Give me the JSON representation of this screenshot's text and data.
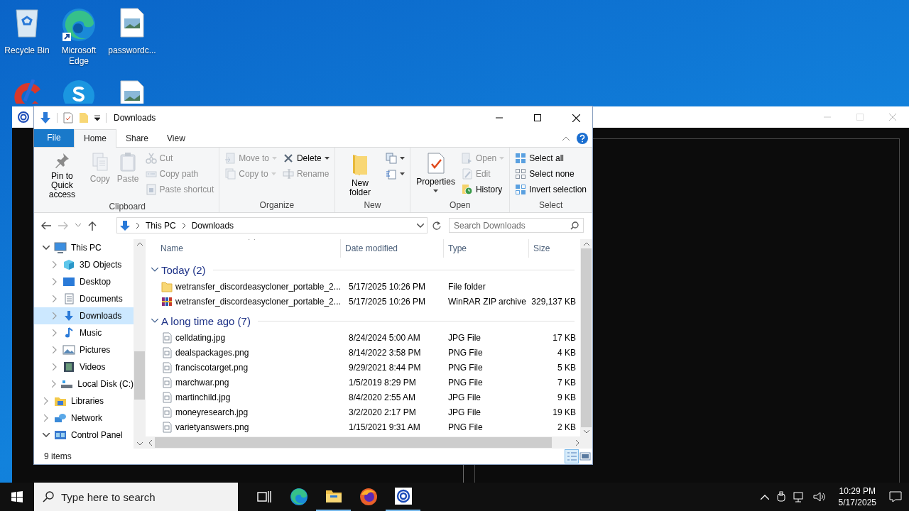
{
  "desktop_icons": [
    {
      "label": "Recycle Bin",
      "kind": "recycle"
    },
    {
      "label": "Microsoft Edge",
      "kind": "edge"
    },
    {
      "label": "passwordc...",
      "kind": "image"
    },
    {
      "kind": "cleaner"
    },
    {
      "kind": "skype"
    },
    {
      "kind": "image"
    }
  ],
  "explorer": {
    "title": "Downloads",
    "tabs": [
      {
        "label": "File",
        "kind": "file",
        "selected": false
      },
      {
        "label": "Home",
        "kind": "tab",
        "selected": true
      },
      {
        "label": "Share",
        "kind": "tab",
        "selected": false
      },
      {
        "label": "View",
        "kind": "tab",
        "selected": false
      }
    ],
    "ribbon": [
      {
        "label": "Clipboard",
        "items": [
          {
            "label": "Pin to Quick access",
            "kind": "large",
            "disabled": false
          },
          {
            "label": "Copy",
            "kind": "large",
            "disabled": true
          },
          {
            "label": "Paste",
            "kind": "large",
            "disabled": true
          },
          {
            "kind": "stack",
            "items": [
              {
                "label": "Cut",
                "disabled": true
              },
              {
                "label": "Copy path",
                "disabled": true
              },
              {
                "label": "Paste shortcut",
                "disabled": true
              }
            ]
          }
        ]
      },
      {
        "label": "Organize",
        "items": [
          {
            "kind": "stack",
            "items": [
              {
                "label": "Move to",
                "disabled": true,
                "dropdown": true
              },
              {
                "label": "Copy to",
                "disabled": true,
                "dropdown": true
              }
            ]
          },
          {
            "kind": "stack",
            "items": [
              {
                "label": "Delete",
                "disabled": false,
                "dropdown": true
              },
              {
                "label": "Rename",
                "disabled": true
              }
            ]
          }
        ]
      },
      {
        "label": "New",
        "items": [
          {
            "label": "New folder",
            "kind": "large",
            "disabled": false
          },
          {
            "kind": "iconstack",
            "items": [
              {
                "disabled": false,
                "dropdown": true
              },
              {
                "disabled": false,
                "dropdown": true
              }
            ]
          }
        ]
      },
      {
        "label": "Open",
        "items": [
          {
            "label": "Properties",
            "kind": "large",
            "disabled": false,
            "dropdown": true
          },
          {
            "kind": "stack",
            "items": [
              {
                "label": "Open",
                "disabled": true,
                "dropdown": true
              },
              {
                "label": "Edit",
                "disabled": true
              },
              {
                "label": "History",
                "disabled": false
              }
            ]
          }
        ]
      },
      {
        "label": "Select",
        "items": [
          {
            "kind": "stack",
            "items": [
              {
                "label": "Select all",
                "disabled": false
              },
              {
                "label": "Select none",
                "disabled": false
              },
              {
                "label": "Invert selection",
                "disabled": false
              }
            ]
          }
        ]
      }
    ],
    "address": {
      "crumbs": [
        "This PC",
        "Downloads"
      ]
    },
    "search": {
      "placeholder": "Search Downloads"
    },
    "nav": [
      {
        "label": "This PC",
        "expanded": true,
        "selected": false,
        "children": [
          {
            "label": "3D Objects",
            "expanded": false,
            "selected": false
          },
          {
            "label": "Desktop",
            "expanded": false,
            "selected": false
          },
          {
            "label": "Documents",
            "expanded": false,
            "selected": false
          },
          {
            "label": "Downloads",
            "expanded": false,
            "selected": true
          },
          {
            "label": "Music",
            "expanded": false,
            "selected": false
          },
          {
            "label": "Pictures",
            "expanded": false,
            "selected": false
          },
          {
            "label": "Videos",
            "expanded": false,
            "selected": false
          },
          {
            "label": "Local Disk (C:)",
            "expanded": false,
            "selected": false
          }
        ]
      },
      {
        "label": "Libraries",
        "expanded": false,
        "selected": false
      },
      {
        "label": "Network",
        "expanded": false,
        "selected": false
      },
      {
        "label": "Control Panel",
        "expanded": true,
        "selected": false
      }
    ],
    "columns": [
      "Name",
      "Date modified",
      "Type",
      "Size"
    ],
    "groups": [
      {
        "label": "Today (2)",
        "rows": [
          {
            "name": "wetransfer_discordeasycloner_portable_2...",
            "date": "5/17/2025 10:26 PM",
            "type": "File folder",
            "kind": "folder"
          },
          {
            "name": "wetransfer_discordeasycloner_portable_2...",
            "date": "5/17/2025 10:26 PM",
            "type": "WinRAR ZIP archive",
            "size": "329,137 KB",
            "kind": "archive"
          }
        ]
      },
      {
        "label": "A long time ago (7)",
        "rows": [
          {
            "name": "celldating.jpg",
            "date": "8/24/2024 5:00 AM",
            "type": "JPG File",
            "size": "17 KB",
            "kind": "image"
          },
          {
            "name": "dealspackages.png",
            "date": "8/14/2022 3:58 PM",
            "type": "PNG File",
            "size": "4 KB",
            "kind": "image"
          },
          {
            "name": "franciscotarget.png",
            "date": "9/29/2021 8:44 PM",
            "type": "PNG File",
            "size": "5 KB",
            "kind": "image"
          },
          {
            "name": "marchwar.png",
            "date": "1/5/2019 8:29 PM",
            "type": "PNG File",
            "size": "7 KB",
            "kind": "image"
          },
          {
            "name": "martinchild.jpg",
            "date": "8/4/2020 2:55 AM",
            "type": "JPG File",
            "size": "9 KB",
            "kind": "image"
          },
          {
            "name": "moneyresearch.jpg",
            "date": "3/2/2020 2:17 PM",
            "type": "JPG File",
            "size": "19 KB",
            "kind": "image"
          },
          {
            "name": "varietyanswers.png",
            "date": "1/15/2021 9:31 AM",
            "type": "PNG File",
            "size": "2 KB",
            "kind": "image"
          }
        ]
      }
    ],
    "status": "9 items"
  },
  "taskbar": {
    "search": {
      "placeholder": "Type here to search"
    },
    "apps": [
      {
        "kind": "taskview",
        "active": false
      },
      {
        "kind": "edge",
        "active": false
      },
      {
        "kind": "explorer",
        "active": true
      },
      {
        "kind": "firefox",
        "active": false
      },
      {
        "kind": "spiral",
        "active": true
      }
    ],
    "time": "10:29 PM",
    "date": "5/17/2025"
  }
}
